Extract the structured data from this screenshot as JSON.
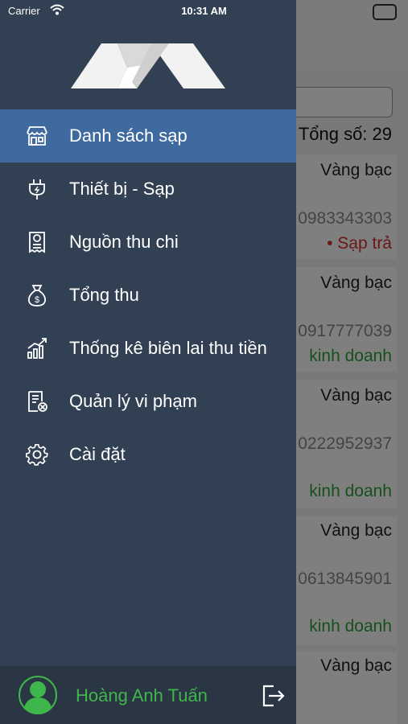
{
  "status_bar": {
    "carrier": "Carrier",
    "time": "10:31 AM"
  },
  "drawer": {
    "menu": [
      {
        "label": "Danh sách sạp",
        "icon": "store-icon",
        "active": true
      },
      {
        "label": "Thiết bị - Sạp",
        "icon": "plug-icon",
        "active": false
      },
      {
        "label": "Nguồn thu chi",
        "icon": "receipt-icon",
        "active": false
      },
      {
        "label": "Tổng thu",
        "icon": "money-bag-icon",
        "active": false
      },
      {
        "label": "Thống kê biên lai thu tiền",
        "icon": "chart-icon",
        "active": false
      },
      {
        "label": "Quản lý vi phạm",
        "icon": "violation-doc-icon",
        "active": false
      },
      {
        "label": "Cài đặt",
        "icon": "gear-icon",
        "active": false
      }
    ],
    "user": {
      "name": "Hoàng Anh Tuấn"
    }
  },
  "background": {
    "total_label": "Tổng số: 29",
    "items": [
      {
        "category": "Vàng bạc",
        "phone": "0983343303",
        "status": "• Sạp trả",
        "status_color": "#d32f2f"
      },
      {
        "category": "Vàng bạc",
        "phone": "0917777039",
        "status": "kinh doanh",
        "status_color": "#2e9e3a"
      },
      {
        "category": "Vàng bạc",
        "phone": "0222952937",
        "status": "kinh doanh",
        "status_color": "#2e9e3a"
      },
      {
        "category": "Vàng bạc",
        "phone": "0613845901",
        "status": "kinh doanh",
        "status_color": "#2e9e3a"
      },
      {
        "category": "Vàng bạc"
      }
    ]
  },
  "colors": {
    "drawer_bg": "#314052",
    "active_item": "#3f6aa0",
    "footer_bg": "#2a3644",
    "user_name": "#3fb64b"
  }
}
